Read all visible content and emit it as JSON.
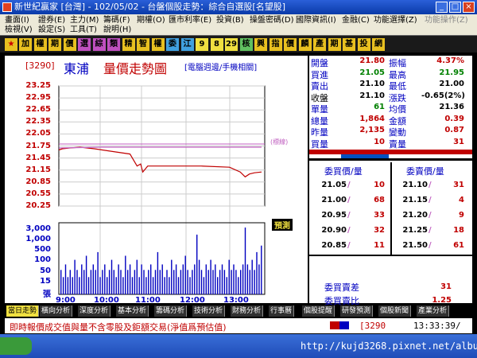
{
  "window": {
    "title": "新世紀贏家 [台灣] - 102/05/02 - 台盤個股走勢：綜合自選股[名望股]"
  },
  "menu": {
    "row1": [
      "畫面(I)",
      "證券(E)",
      "主力(M)",
      "籌碼(F)",
      "期權(O)",
      "匯市利率(E)",
      "投資(B)",
      "操盤密碼(D)",
      "國際資訊(I)",
      "金融(C)",
      "功能選擇(Z)",
      "功能操作(Z)"
    ],
    "row2": [
      "檢視(V)",
      "設定(S)",
      "工具(T)",
      "說明(H)"
    ]
  },
  "toolbar": {
    "items": [
      {
        "label": "加",
        "bg": "#e8c020"
      },
      {
        "label": "權",
        "bg": "#e8c020"
      },
      {
        "label": "期",
        "bg": "#e8c020"
      },
      {
        "label": "價",
        "bg": "#e8c020"
      },
      {
        "label": "選",
        "bg": "#c050c0"
      },
      {
        "label": "綜",
        "bg": "#c050c0"
      },
      {
        "label": "類",
        "bg": "#c050c0"
      },
      {
        "label": "精",
        "bg": "#e8c020"
      },
      {
        "label": "智",
        "bg": "#e8c020"
      },
      {
        "label": "權",
        "bg": "#e8c020"
      },
      {
        "label": "委",
        "bg": "#40a0e0"
      },
      {
        "label": "江",
        "bg": "#40a0e0"
      },
      {
        "label": "9",
        "bg": "#f0e040"
      },
      {
        "label": "8",
        "bg": "#f0e040"
      },
      {
        "label": "29",
        "bg": "#f0e040"
      },
      {
        "label": "核",
        "bg": "#60c060"
      },
      {
        "label": "興",
        "bg": "#e8c020"
      },
      {
        "label": "指",
        "bg": "#e8c020"
      },
      {
        "label": "價",
        "bg": "#e8c020"
      },
      {
        "label": "麟",
        "bg": "#e8c020"
      },
      {
        "label": "產",
        "bg": "#e8c020"
      },
      {
        "label": "期",
        "bg": "#e8c020"
      },
      {
        "label": "基",
        "bg": "#e8c020"
      },
      {
        "label": "投",
        "bg": "#e8c020"
      },
      {
        "label": "網",
        "bg": "#e8c020"
      }
    ]
  },
  "chart_header": {
    "code": "[3290]",
    "name": "東浦",
    "title": "量價走勢圖",
    "subtitle": "[電腦週邊/手機相關]"
  },
  "chart_data": {
    "type": "line",
    "price_axis_ticks": [
      "23.25",
      "22.95",
      "22.65",
      "22.35",
      "22.05",
      "21.75",
      "21.45",
      "21.15",
      "20.85",
      "20.55",
      "20.25"
    ],
    "volume_axis_ticks": [
      "3,000",
      "1,000",
      "500",
      "100",
      "50",
      "15",
      "張"
    ],
    "time_ticks": [
      "9:00",
      "10:00",
      "11:00",
      "12:00",
      "13:00"
    ],
    "ylim": [
      20.25,
      23.25
    ],
    "reference_price": 21.8,
    "reference_label": "(標線)",
    "avg_label": "預測",
    "series": [
      {
        "name": "price",
        "color": "#c00000",
        "points": [
          [
            0,
            21.65
          ],
          [
            5,
            21.68
          ],
          [
            15,
            21.7
          ],
          [
            30,
            21.72
          ],
          [
            50,
            21.68
          ],
          [
            80,
            21.6
          ],
          [
            100,
            21.55
          ],
          [
            110,
            21.25
          ],
          [
            115,
            21.3
          ],
          [
            118,
            21.1
          ],
          [
            125,
            21.25
          ],
          [
            150,
            21.25
          ],
          [
            200,
            21.25
          ],
          [
            240,
            21.22
          ],
          [
            255,
            21.1
          ],
          [
            262,
            20.98
          ],
          [
            268,
            21.05
          ],
          [
            275,
            21.08
          ],
          [
            285,
            21.1
          ]
        ]
      },
      {
        "name": "average",
        "color": "#c060c0",
        "points": [
          [
            0,
            21.7
          ],
          [
            60,
            21.72
          ],
          [
            130,
            21.72
          ],
          [
            200,
            21.72
          ],
          [
            285,
            21.72
          ]
        ]
      }
    ],
    "volume": [
      2,
      1,
      3,
      1,
      2,
      1,
      4,
      2,
      1,
      3,
      2,
      5,
      1,
      2,
      3,
      2,
      6,
      1,
      2,
      3,
      1,
      2,
      4,
      2,
      1,
      3,
      2,
      1,
      5,
      2,
      3,
      1,
      2,
      4,
      1,
      3,
      2,
      1,
      2,
      3,
      1,
      2,
      6,
      2,
      3,
      1,
      2,
      1,
      4,
      2,
      3,
      1,
      2,
      3,
      5,
      2,
      1,
      2,
      3,
      12,
      4,
      2,
      1,
      3,
      2,
      4,
      2,
      3,
      1,
      2,
      3,
      2,
      1,
      4,
      2,
      3,
      2,
      1,
      2,
      3,
      15,
      3,
      2,
      4,
      2,
      6,
      3,
      8
    ]
  },
  "quote": {
    "rows": [
      {
        "l1": "開盤",
        "v1": "21.80",
        "c1": "#c00000",
        "l2": "振幅",
        "v2": "4.37%",
        "c2": "#c00000"
      },
      {
        "l1": "買進",
        "v1": "21.05",
        "c1": "#008000",
        "l2": "最高",
        "v2": "21.95",
        "c2": "#008000"
      },
      {
        "l1": "賣出",
        "v1": "21.10",
        "c1": "#000000",
        "l2": "最低",
        "v2": "21.00",
        "c2": "#000000"
      },
      {
        "l1": "收盤",
        "v1": "21.10",
        "c1": "#000000",
        "l2": "漲跌",
        "v2": "-0.65(2%)",
        "c2": "#000000"
      },
      {
        "l1": "單量",
        "v1": "61",
        "c1": "#008000",
        "l2": "均價",
        "v2": "21.36",
        "c2": "#000000"
      },
      {
        "l1": "總量",
        "v1": "1,864",
        "c1": "#c00000",
        "l2": "金額",
        "v2": "0.39",
        "c2": "#c00000"
      },
      {
        "l1": "昨量",
        "v1": "2,135",
        "c1": "#c00000",
        "l2": "變動",
        "v2": "0.87",
        "c2": "#c00000"
      },
      {
        "l1": "買量",
        "v1": "10",
        "c1": "#c00000",
        "l2": "賣量",
        "v2": "31",
        "c2": "#c00000"
      }
    ]
  },
  "order_book": {
    "bid_header": "委買價/量",
    "ask_header": "委賣價/量",
    "rows": [
      {
        "bid_price": "21.05",
        "bid_qty": "10",
        "ask_price": "21.10",
        "ask_qty": "31"
      },
      {
        "bid_price": "21.00",
        "bid_qty": "68",
        "ask_price": "21.15",
        "ask_qty": "4"
      },
      {
        "bid_price": "20.95",
        "bid_qty": "33",
        "ask_price": "21.20",
        "ask_qty": "9"
      },
      {
        "bid_price": "20.90",
        "bid_qty": "32",
        "ask_price": "21.25",
        "ask_qty": "18"
      },
      {
        "bid_price": "20.85",
        "bid_qty": "11",
        "ask_price": "21.50",
        "ask_qty": "61"
      }
    ],
    "diff_label": "委買賣差",
    "diff_value": "31",
    "ratio_label": "委買賣比",
    "ratio_value": "1.25"
  },
  "tabs": [
    "當日走勢",
    "橫向分析",
    "深度分析",
    "基本分析",
    "籌碼分析",
    "技術分析",
    "財務分析",
    "行事曆",
    "個股提醒",
    "研發預測",
    "個股新聞",
    "產業分析"
  ],
  "status": {
    "message": "即時報價成交值與量不含零股及鉅額交易(淨值爲預估值)",
    "code": "[3290",
    "time": "13:33:39/"
  },
  "taskbar": {
    "url": "http://kujd3268.pixnet.net/album"
  }
}
